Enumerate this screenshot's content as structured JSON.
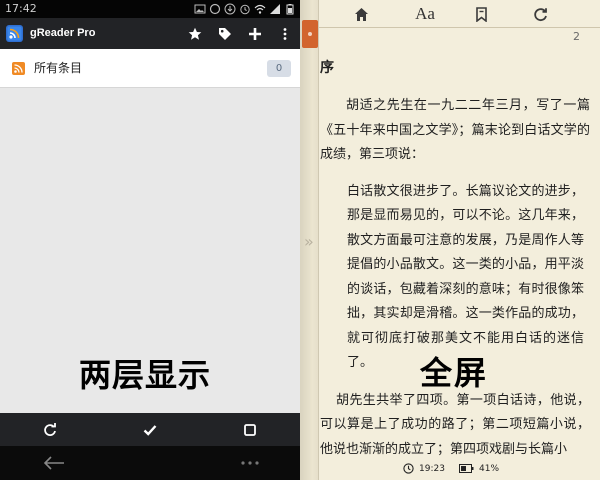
{
  "colors": {
    "left_bg": "#e8e8e8",
    "actionbar": "#222326",
    "reader_bg": "#f3eedc",
    "bookmark": "#d2642e",
    "rss_orange": "#f08a24",
    "count_badge": "#d7dde6"
  },
  "status_bar": {
    "time": "17:42",
    "icons": [
      "image-icon",
      "ring-icon",
      "download-icon",
      "alarm-icon",
      "wifi-icon",
      "signal-icon",
      "battery-icon"
    ]
  },
  "app_bar": {
    "title": "gReader Pro",
    "actions": [
      "star-icon",
      "tag-icon",
      "plus-icon",
      "overflow-menu-icon"
    ]
  },
  "feed_list": {
    "items": [
      {
        "label": "所有条目",
        "count": "0",
        "icon": "rss-icon"
      }
    ]
  },
  "left_caption": "两层显示",
  "bottom_toolbar": {
    "actions": [
      "refresh-icon",
      "check-icon",
      "square-icon"
    ]
  },
  "nav_bar": {
    "actions": [
      "back-arrow-icon",
      "more-dots-icon"
    ]
  },
  "reader": {
    "toolbar": {
      "font_label": "Aa",
      "actions": [
        "home-icon",
        "font-size-button",
        "bookmark-icon",
        "sync-icon"
      ]
    },
    "page_number": "2",
    "chapter_title": "序",
    "paragraphs": [
      "胡适之先生在一九二二年三月，写了一篇《五十年来中国之文学》；篇末论到白话文学的成绩，第三项说：",
      "白话散文很进步了。长篇议论文的进步，那是显而易见的，可以不论。这几年来，散文方面最可注意的发展，乃是周作人等提倡的小品散文。这一类的小品，用平淡的谈话，包藏着深刻的意味；有时很像笨拙，其实却是滑稽。这一类作品的成功，就可彻底打破那美文不能用白话的迷信了。",
      "胡先生共举了四项。第一项白话诗，他说，可以算是上了成功的路了；第二项短篇小说，他说也渐渐的成立了；第四项戏剧与长篇小"
    ],
    "status": {
      "clock": "19:23",
      "battery": "41%"
    }
  },
  "right_caption": "全屏"
}
